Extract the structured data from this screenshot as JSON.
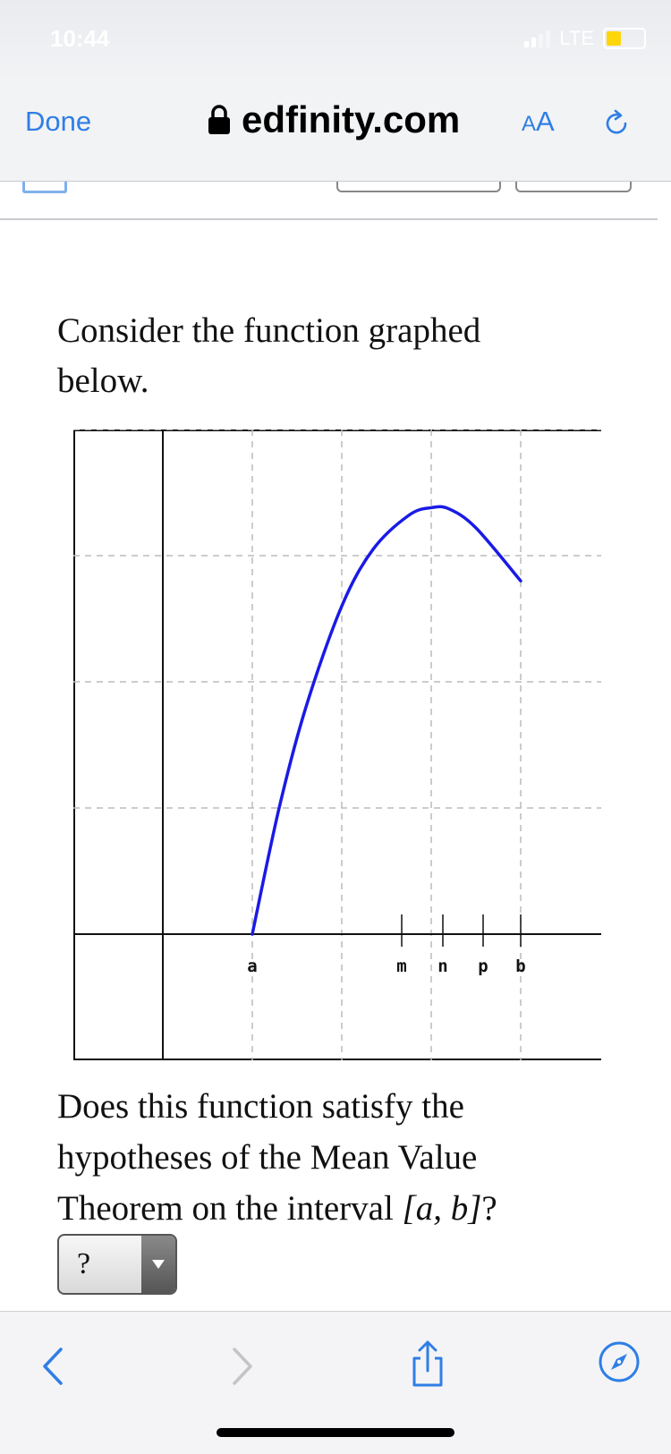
{
  "status_bar": {
    "time": "10:44",
    "network": "LTE",
    "signal_bars_filled": 2,
    "signal_bars_total": 4,
    "battery_color": "#ffd60a"
  },
  "browser": {
    "done_label": "Done",
    "domain": "edfinity.com",
    "text_size_label": "AA",
    "accent_color": "#2f7ee6",
    "icons": {
      "lock": "lock-icon",
      "reload": "reload-icon"
    }
  },
  "problem": {
    "prompt": "Consider the function graphed below.",
    "question_before": "Does this function satisfy the hypotheses of the Mean Value Theorem on the interval ",
    "question_math": "[a, b]",
    "question_after": "?",
    "answer": {
      "selected": "?"
    }
  },
  "chart_data": {
    "type": "line",
    "title": "",
    "xlabel": "",
    "ylabel": "",
    "grid": true,
    "x_tick_labels": [
      "a",
      "m",
      "n",
      "p",
      "b"
    ],
    "x_tick_positions": [
      1,
      2.67,
      3.13,
      3.58,
      4
    ],
    "xlim": [
      -1,
      4.9
    ],
    "ylim": [
      -1,
      4
    ],
    "series": [
      {
        "color": "#1a1ae6",
        "x": [
          1,
          1.3,
          1.6,
          2.0,
          2.35,
          2.75,
          3.0,
          3.2,
          3.5,
          4.0
        ],
        "y": [
          0,
          1.0,
          1.8,
          2.6,
          3.05,
          3.32,
          3.38,
          3.37,
          3.22,
          2.8
        ]
      }
    ]
  },
  "toolbar": {
    "icons": [
      "back-icon",
      "forward-icon",
      "share-icon",
      "compass-icon"
    ]
  }
}
